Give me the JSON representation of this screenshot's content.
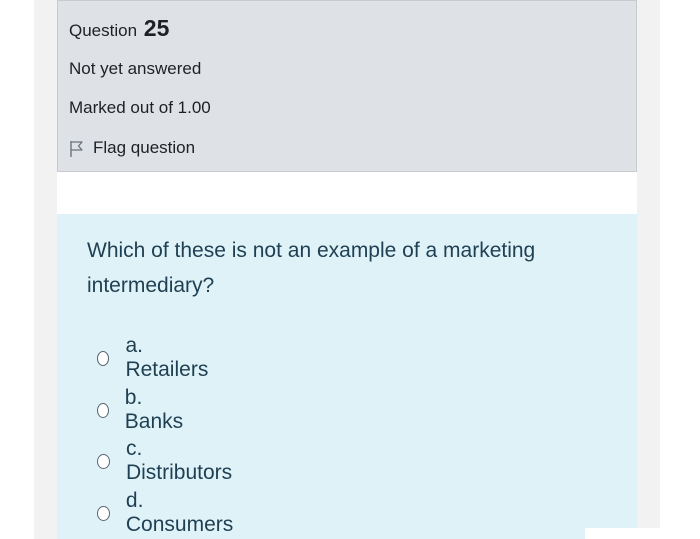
{
  "question_info": {
    "title_prefix": "Question",
    "number": "25",
    "status": "Not yet answered",
    "marks": "Marked out of 1.00",
    "flag_label": "Flag question"
  },
  "question": {
    "text": "Which of these is not an example of a marketing intermediary?",
    "answers": [
      {
        "label": "a. Retailers"
      },
      {
        "label": "b. Banks"
      },
      {
        "label": "c. Distributors"
      },
      {
        "label": "d. Consumers"
      }
    ]
  },
  "icons": {
    "flag": "flag-icon",
    "radio": "radio-icon"
  },
  "colors": {
    "info_bg": "#dee2e6",
    "content_bg": "#def2f8",
    "text_dark": "#1d2125",
    "text_question": "#1f3f52"
  }
}
